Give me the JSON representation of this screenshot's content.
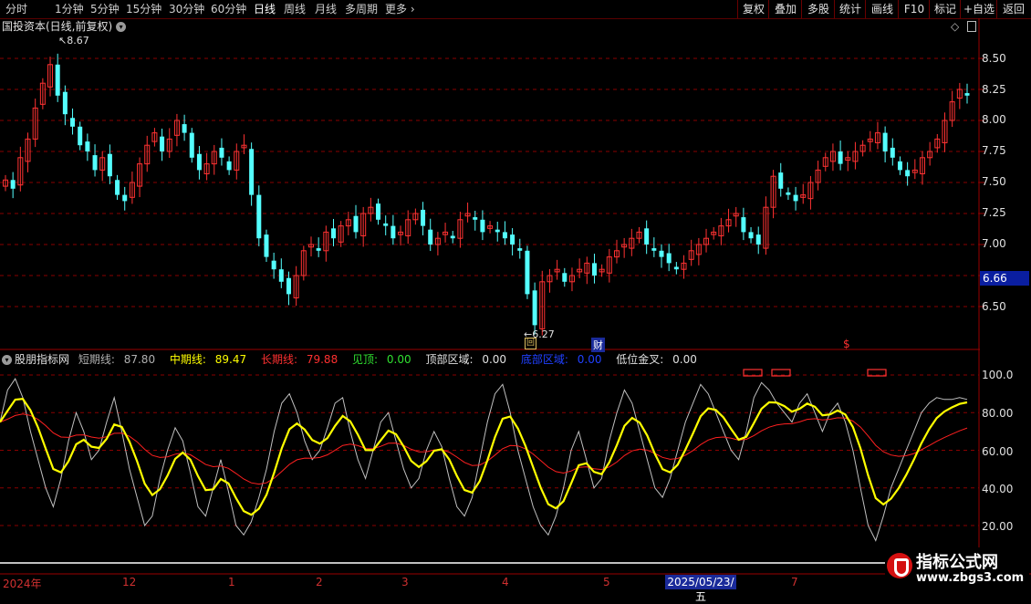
{
  "toolbar": {
    "timeframes": [
      "分时",
      "1分钟",
      "5分钟",
      "15分钟",
      "30分钟",
      "60分钟",
      "日线",
      "周线",
      "月线",
      "多周期",
      "更多"
    ],
    "active_timeframe": "日线",
    "right_buttons": [
      "复权",
      "叠加",
      "多股",
      "统计",
      "画线",
      "F10",
      "标记",
      "+自选",
      "返回"
    ]
  },
  "main_title": "国投资本(日线,前复权)",
  "high_label": "8.67",
  "low_label": "6.27",
  "price_axis": [
    "8.50",
    "8.25",
    "8.00",
    "7.75",
    "7.50",
    "7.25",
    "7.00",
    "6.50"
  ],
  "current_price": "6.66",
  "event_markers": {
    "finance": "财",
    "dividend": "$"
  },
  "indicator": {
    "name": "股朋指标网",
    "short_label": "短期线:",
    "short_value": "87.80",
    "mid_label": "中期线:",
    "mid_value": "89.47",
    "long_label": "长期线:",
    "long_value": "79.88",
    "top_label": "见顶:",
    "top_value": "0.00",
    "top_zone_label": "顶部区域:",
    "top_zone_value": "0.00",
    "bottom_zone_label": "底部区域:",
    "bottom_zone_value": "0.00",
    "golden_cross_label": "低位金叉:",
    "golden_cross_value": "0.00",
    "axis": [
      "100.0",
      "80.00",
      "60.00",
      "40.00",
      "20.00"
    ]
  },
  "time_axis": {
    "labels": [
      "2024年",
      "12",
      "1",
      "2",
      "3",
      "4",
      "5",
      "7"
    ],
    "selected_date": "2025/05/23/五"
  },
  "watermark": {
    "line1": "指标公式网",
    "line2": "www.zbgs3.com"
  },
  "colors": {
    "up": "#ff3232",
    "down": "#54ffff",
    "mid": "#ffff00",
    "long": "#ff2020",
    "short": "#c0c0c0",
    "grid": "#8a0000"
  },
  "chart_data": {
    "type": "candlestick",
    "price_range": [
      6.27,
      8.67
    ],
    "closes": [
      7.52,
      7.45,
      7.7,
      7.85,
      8.1,
      8.3,
      8.45,
      8.2,
      8.05,
      7.95,
      7.8,
      7.75,
      7.6,
      7.7,
      7.55,
      7.4,
      7.35,
      7.5,
      7.65,
      7.8,
      7.9,
      7.75,
      7.85,
      8.0,
      7.9,
      7.7,
      7.6,
      7.65,
      7.75,
      7.7,
      7.6,
      7.75,
      7.8,
      7.4,
      7.05,
      6.9,
      6.8,
      6.7,
      6.6,
      6.75,
      6.95,
      7.0,
      6.95,
      7.1,
      7.05,
      7.15,
      7.2,
      7.1,
      7.25,
      7.3,
      7.2,
      7.15,
      7.05,
      7.1,
      7.2,
      7.25,
      7.15,
      7.0,
      7.05,
      7.1,
      7.05,
      7.2,
      7.25,
      7.2,
      7.1,
      7.15,
      7.1,
      7.05,
      7.0,
      6.95,
      6.6,
      6.35,
      6.7,
      6.75,
      6.8,
      6.7,
      6.75,
      6.8,
      6.85,
      6.75,
      6.8,
      6.9,
      6.95,
      7.0,
      7.05,
      7.1,
      7.0,
      6.95,
      6.9,
      6.85,
      6.8,
      6.85,
      6.95,
      7.0,
      7.05,
      7.1,
      7.15,
      7.2,
      7.25,
      7.1,
      7.05,
      7.0,
      7.3,
      7.55,
      7.45,
      7.4,
      7.35,
      7.4,
      7.5,
      7.6,
      7.7,
      7.75,
      7.65,
      7.7,
      7.75,
      7.8,
      7.85,
      7.9,
      7.75,
      7.7,
      7.6,
      7.55,
      7.6,
      7.7,
      7.75,
      7.85,
      8.0,
      8.15,
      8.25,
      8.2
    ],
    "short_line": [
      75,
      92,
      98,
      88,
      70,
      55,
      40,
      30,
      45,
      65,
      80,
      70,
      55,
      60,
      75,
      88,
      70,
      50,
      35,
      20,
      25,
      45,
      60,
      72,
      65,
      48,
      30,
      25,
      40,
      55,
      38,
      20,
      15,
      22,
      35,
      50,
      70,
      85,
      90,
      80,
      65,
      55,
      60,
      72,
      85,
      88,
      70,
      55,
      45,
      60,
      75,
      80,
      65,
      50,
      40,
      45,
      60,
      70,
      62,
      45,
      30,
      25,
      35,
      55,
      75,
      90,
      95,
      80,
      60,
      45,
      30,
      20,
      15,
      25,
      40,
      60,
      70,
      55,
      40,
      45,
      65,
      80,
      92,
      85,
      70,
      55,
      40,
      35,
      45,
      60,
      75,
      85,
      95,
      90,
      80,
      70,
      60,
      55,
      70,
      88,
      96,
      92,
      85,
      80,
      75,
      85,
      90,
      80,
      70,
      80,
      85,
      75,
      60,
      40,
      20,
      12,
      25,
      40,
      50,
      60,
      70,
      80,
      85,
      88,
      87,
      87,
      88,
      87
    ]
  }
}
